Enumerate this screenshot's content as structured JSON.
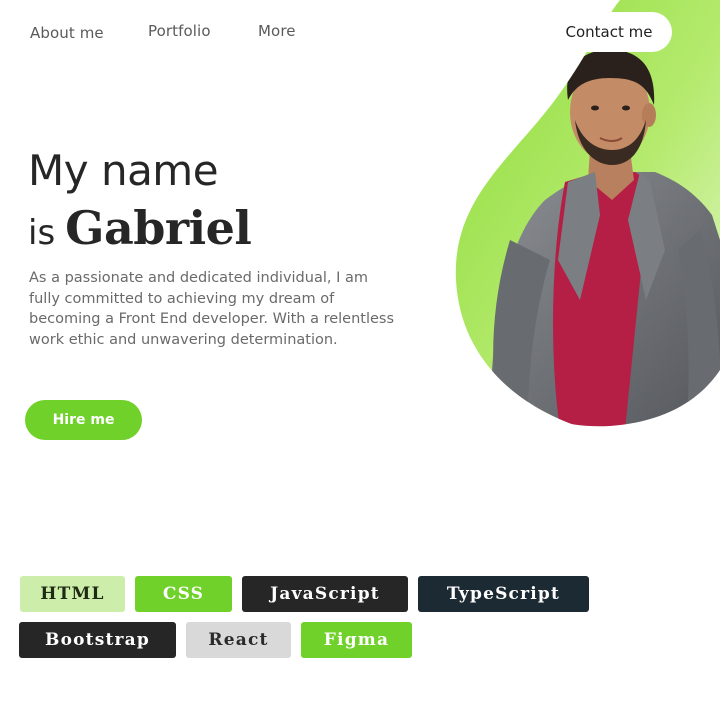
{
  "nav": {
    "about": "About me",
    "portfolio": "Portfolio",
    "more": "More",
    "contact": "Contact me"
  },
  "hero": {
    "line1": "My name",
    "line2_prefix": "is",
    "name": "Gabriel",
    "description": "As a passionate and dedicated individual, I am fully committed to achieving my dream of becoming a Front End developer. With a relentless work ethic and unwavering determination.",
    "hire_label": "Hire me",
    "portrait_icon": "portrait-photo"
  },
  "skills": [
    {
      "label": "HTML",
      "bg": "#cdeeaa",
      "fg": "#1f2a14"
    },
    {
      "label": "CSS",
      "bg": "#6fd12a",
      "fg": "#ffffff"
    },
    {
      "label": "JavaScript",
      "bg": "#262626",
      "fg": "#ffffff"
    },
    {
      "label": "TypeScript",
      "bg": "#1c2a33",
      "fg": "#ffffff"
    },
    {
      "label": "Bootstrap",
      "bg": "#262626",
      "fg": "#ffffff"
    },
    {
      "label": "React",
      "bg": "#d9d9d9",
      "fg": "#2a2a2a"
    },
    {
      "label": "Figma",
      "bg": "#6fd12a",
      "fg": "#ffffff"
    }
  ],
  "colors": {
    "accent": "#6fd12a",
    "accent_light": "#cdeeaa",
    "text_dark": "#262626",
    "text_muted": "#6a6a6a"
  }
}
